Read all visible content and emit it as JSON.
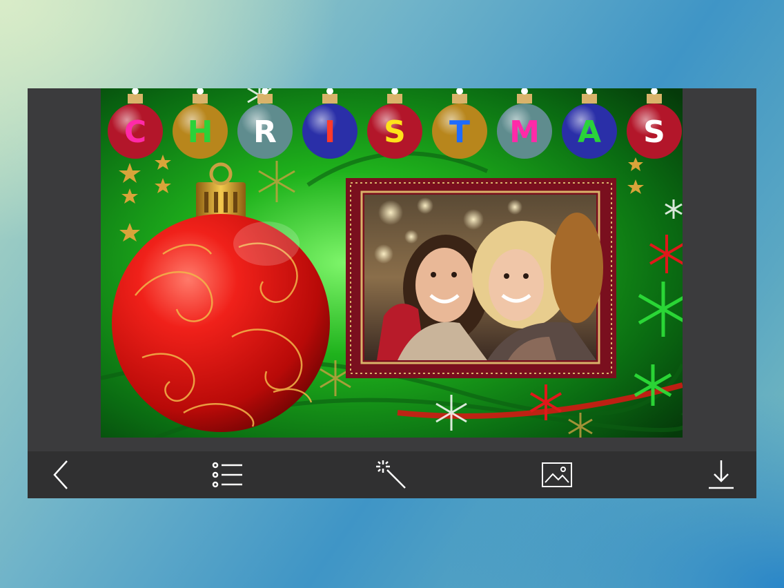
{
  "card": {
    "title_letters": [
      "C",
      "H",
      "R",
      "I",
      "S",
      "T",
      "M",
      "A",
      "S"
    ],
    "letter_colors": [
      "#ff2aa8",
      "#2ad23a",
      "#ffffff",
      "#ff3a2a",
      "#ffe21a",
      "#1e6bff",
      "#ff2aa8",
      "#2ad23a",
      "#ffffff"
    ],
    "bulb_colors": [
      "#b3162a",
      "#b8861c",
      "#5f8c8e",
      "#2a2fa8",
      "#b3162a",
      "#b8861c",
      "#5f8c8e",
      "#2a2fa8",
      "#b3162a"
    ]
  },
  "colors": {
    "panel_bg": "#3b3b3d",
    "toolbar_bg": "#303031",
    "card_green": "#1aa51a",
    "ornament_red": "#e2140f",
    "frame_maroon": "#7a0f1e",
    "icon_white": "#ffffff"
  },
  "toolbar": {
    "buttons": [
      {
        "name": "back",
        "icon": "chevron-left-icon"
      },
      {
        "name": "frames-list",
        "icon": "list-icon"
      },
      {
        "name": "effects",
        "icon": "magic-wand-icon"
      },
      {
        "name": "gallery",
        "icon": "image-icon"
      },
      {
        "name": "save",
        "icon": "download-icon"
      }
    ]
  }
}
